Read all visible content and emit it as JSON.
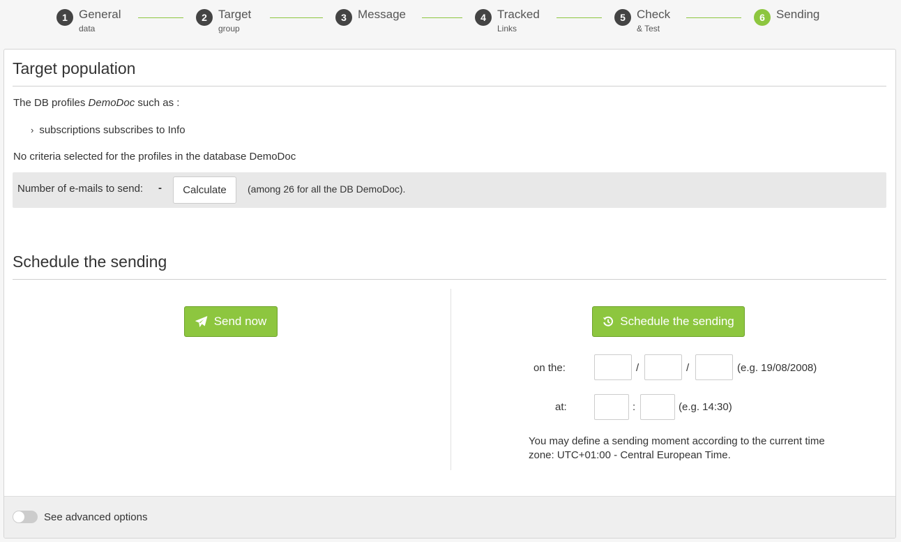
{
  "wizard": {
    "steps": [
      {
        "number": "1",
        "label": "General",
        "sublabel": "data",
        "active": false
      },
      {
        "number": "2",
        "label": "Target",
        "sublabel": "group",
        "active": false
      },
      {
        "number": "3",
        "label": "Message",
        "sublabel": "",
        "active": false
      },
      {
        "number": "4",
        "label": "Tracked",
        "sublabel": "Links",
        "active": false
      },
      {
        "number": "5",
        "label": "Check",
        "sublabel": "& Test",
        "active": false
      },
      {
        "number": "6",
        "label": "Sending",
        "sublabel": "",
        "active": true
      }
    ]
  },
  "target": {
    "title": "Target population",
    "intro_prefix": "The DB profiles",
    "intro_db": "DemoDoc",
    "intro_suffix": "such as :",
    "criterion": "subscriptions subscribes to Info",
    "no_criteria": "No criteria selected for the profiles in the database DemoDoc",
    "count_label": "Number of e-mails to send:",
    "count_value": "-",
    "calculate_label": "Calculate",
    "among_text": "(among 26 for all the DB DemoDoc)."
  },
  "schedule": {
    "title": "Schedule the sending",
    "send_now_label": "Send now",
    "schedule_label": "Schedule the sending",
    "on_the_label": "on the:",
    "date_separator": "/",
    "date_example": "(e.g. 19/08/2008)",
    "at_label": "at:",
    "time_separator": ":",
    "time_example": "(e.g. 14:30)",
    "timezone_note_line1": "You may define a sending moment according to the current time",
    "timezone_note_line2": "zone: UTC+01:00 - Central European Time."
  },
  "footer": {
    "advanced_label": "See advanced options",
    "advanced_enabled": false
  },
  "colors": {
    "accent_green": "#8dc63f",
    "step_dark": "#444444"
  }
}
